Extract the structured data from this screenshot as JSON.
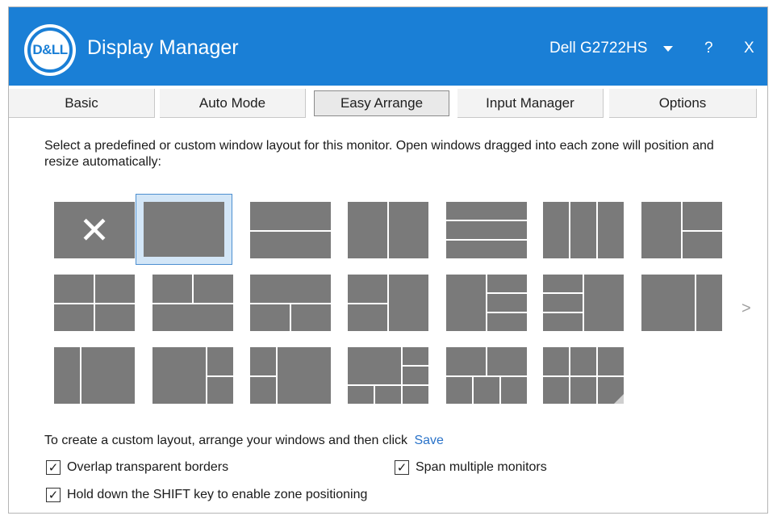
{
  "app": {
    "logo_text": "D&LL",
    "title": "Display Manager",
    "monitor": "Dell G2722HS",
    "help": "?",
    "close": "X"
  },
  "tabs": [
    {
      "label": "Basic"
    },
    {
      "label": "Auto Mode"
    },
    {
      "label": "Easy Arrange",
      "active": true
    },
    {
      "label": "Input Manager"
    },
    {
      "label": "Options"
    }
  ],
  "intro": "Select a predefined or custom window layout for this monitor.  Open windows dragged into each zone will position and resize automatically:",
  "layouts": {
    "selected": "single-full",
    "x_mark": "✕",
    "next_arrow": ">"
  },
  "custom": {
    "text": "To create a custom layout, arrange your windows and then click",
    "save_label": "Save"
  },
  "options": {
    "overlap": {
      "label": "Overlap transparent borders",
      "checked": true
    },
    "span": {
      "label": "Span multiple monitors",
      "checked": true
    },
    "shift": {
      "label": "Hold down the SHIFT key to enable zone positioning",
      "checked": true
    }
  },
  "colors": {
    "title_bar": "#1a7fd6",
    "zone_fill": "#7a7a7a",
    "selection": "#d3e6f7",
    "link": "#2a73c9"
  }
}
